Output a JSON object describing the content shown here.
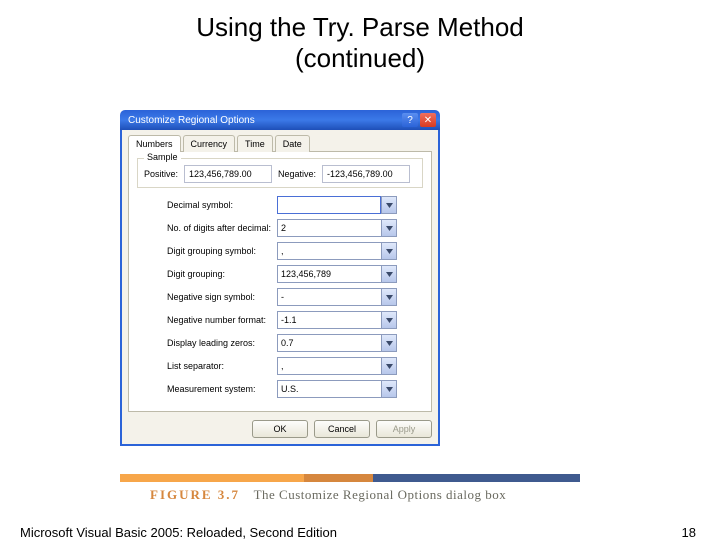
{
  "slide": {
    "title_line1": "Using the Try. Parse Method",
    "title_line2": "(continued)"
  },
  "dialog": {
    "title": "Customize Regional Options",
    "help_icon": "?",
    "close_icon": "✕",
    "tabs": {
      "numbers": "Numbers",
      "currency": "Currency",
      "time": "Time",
      "date": "Date"
    },
    "sample": {
      "legend": "Sample",
      "positive_label": "Positive:",
      "positive_value": "123,456,789.00",
      "negative_label": "Negative:",
      "negative_value": "-123,456,789.00"
    },
    "fields": {
      "decimal_symbol": {
        "label": "Decimal symbol:",
        "value": ""
      },
      "digits_after": {
        "label": "No. of digits after decimal:",
        "value": "2"
      },
      "grouping_symbol": {
        "label": "Digit grouping symbol:",
        "value": ","
      },
      "digit_grouping": {
        "label": "Digit grouping:",
        "value": "123,456,789"
      },
      "neg_sign": {
        "label": "Negative sign symbol:",
        "value": "-"
      },
      "neg_format": {
        "label": "Negative number format:",
        "value": "-1.1"
      },
      "leading_zeros": {
        "label": "Display leading zeros:",
        "value": "0.7"
      },
      "list_sep": {
        "label": "List separator:",
        "value": ","
      },
      "measurement": {
        "label": "Measurement system:",
        "value": "U.S."
      }
    },
    "buttons": {
      "ok": "OK",
      "cancel": "Cancel",
      "apply": "Apply"
    }
  },
  "figure": {
    "number": "FIGURE 3.7",
    "caption": "The Customize Regional Options dialog box"
  },
  "footer": {
    "left": "Microsoft Visual Basic 2005: Reloaded, Second Edition",
    "page": "18"
  }
}
